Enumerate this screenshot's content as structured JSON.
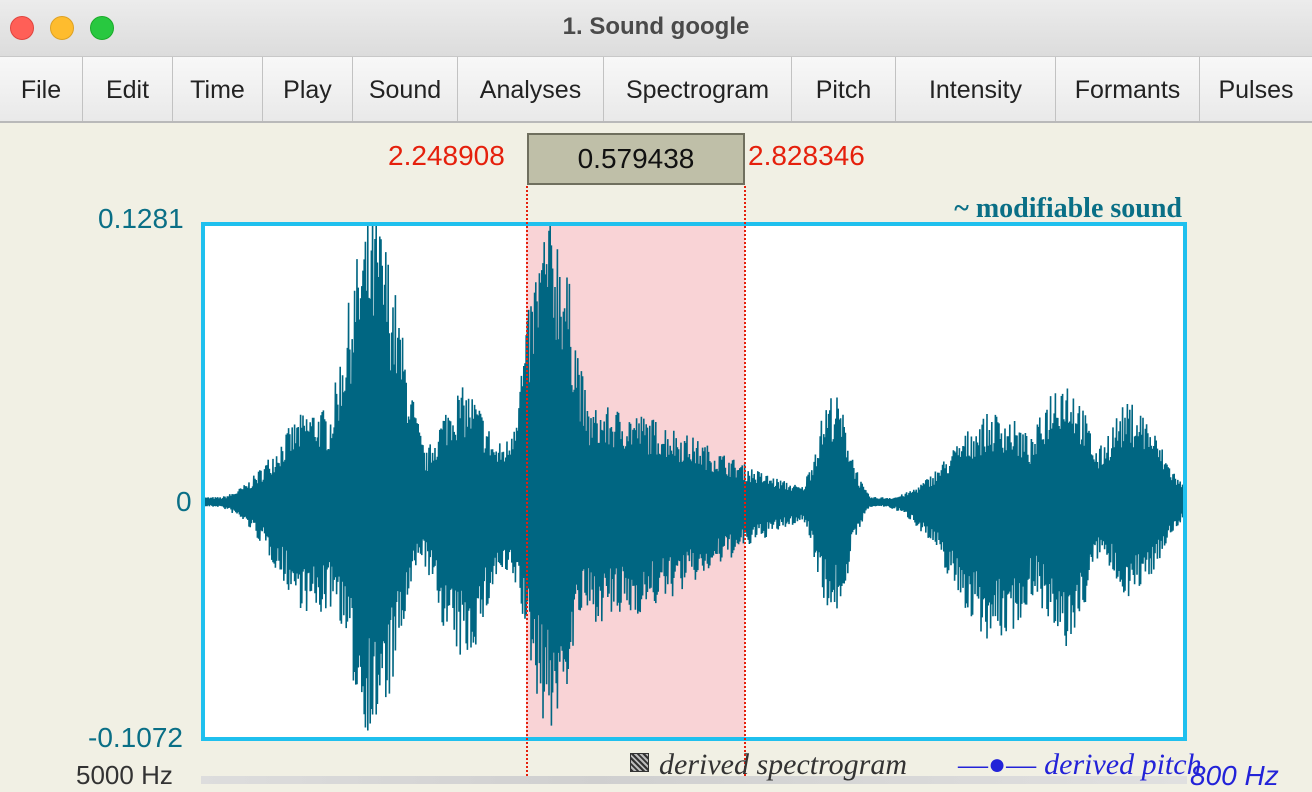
{
  "window": {
    "title": "1. Sound google",
    "controls": [
      "close",
      "minimize",
      "maximize"
    ]
  },
  "menu": [
    "File",
    "Edit",
    "Time",
    "Play",
    "Sound",
    "Analyses",
    "Spectrogram",
    "Pitch",
    "Intensity",
    "Formants",
    "Pulses"
  ],
  "selection": {
    "start": "2.248908",
    "duration": "0.579438",
    "end": "2.828346"
  },
  "waveform": {
    "label": "~ modifiable sound",
    "y_max": "0.1281",
    "y_zero": "0",
    "y_min": "-0.1072"
  },
  "bottom_panel": {
    "freq_label": "5000 Hz",
    "spectrogram_legend": "derived spectrogram",
    "pitch_legend": "derived pitch",
    "pitch_icon": "—●—",
    "pitch_hz": "800 Hz"
  },
  "colors": {
    "waveform": "#006682",
    "panel_border": "#1fc0ee",
    "selection_fill": "#f9d3d6",
    "selection_text": "#e5200c",
    "axis_text": "#0a6f86",
    "pitch": "#2323d8"
  }
}
